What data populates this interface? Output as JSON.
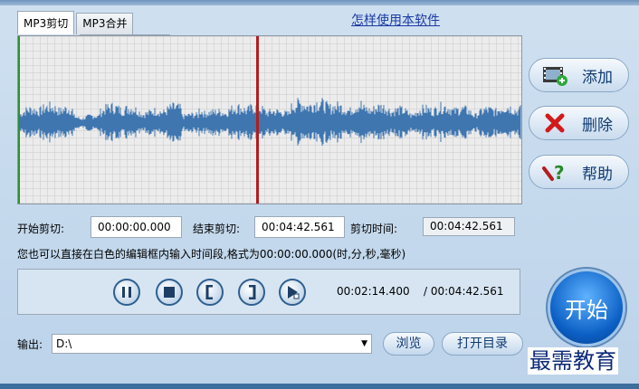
{
  "tabs": [
    {
      "label": "MP3剪切",
      "active": true
    },
    {
      "label": "MP3合并",
      "active": false
    }
  ],
  "help_link": "怎样使用本软件",
  "side_buttons": {
    "add": "添加",
    "delete": "删除",
    "help": "帮助"
  },
  "times": {
    "start_label": "开始剪切:",
    "start_value": "00:00:00.000",
    "end_label": "结束剪切:",
    "end_value": "00:04:42.561",
    "cut_label": "剪切时间:",
    "cut_value": "00:04:42.561"
  },
  "hint": "您也可以直接在白色的编辑框内输入时间段,格式为00:00:00.000(时,分,秒,毫秒)",
  "transport": {
    "current": "00:02:14.400",
    "total": "/ 00:04:42.561"
  },
  "start_button": "开始",
  "output": {
    "label": "输出:",
    "path": "D:\\",
    "browse": "浏览",
    "open_dir": "打开目录"
  },
  "watermark": "最需教育",
  "colors": {
    "waveform": "#3f76b0",
    "playhead": "#b01e1e",
    "accent": "#0b5fc4"
  }
}
